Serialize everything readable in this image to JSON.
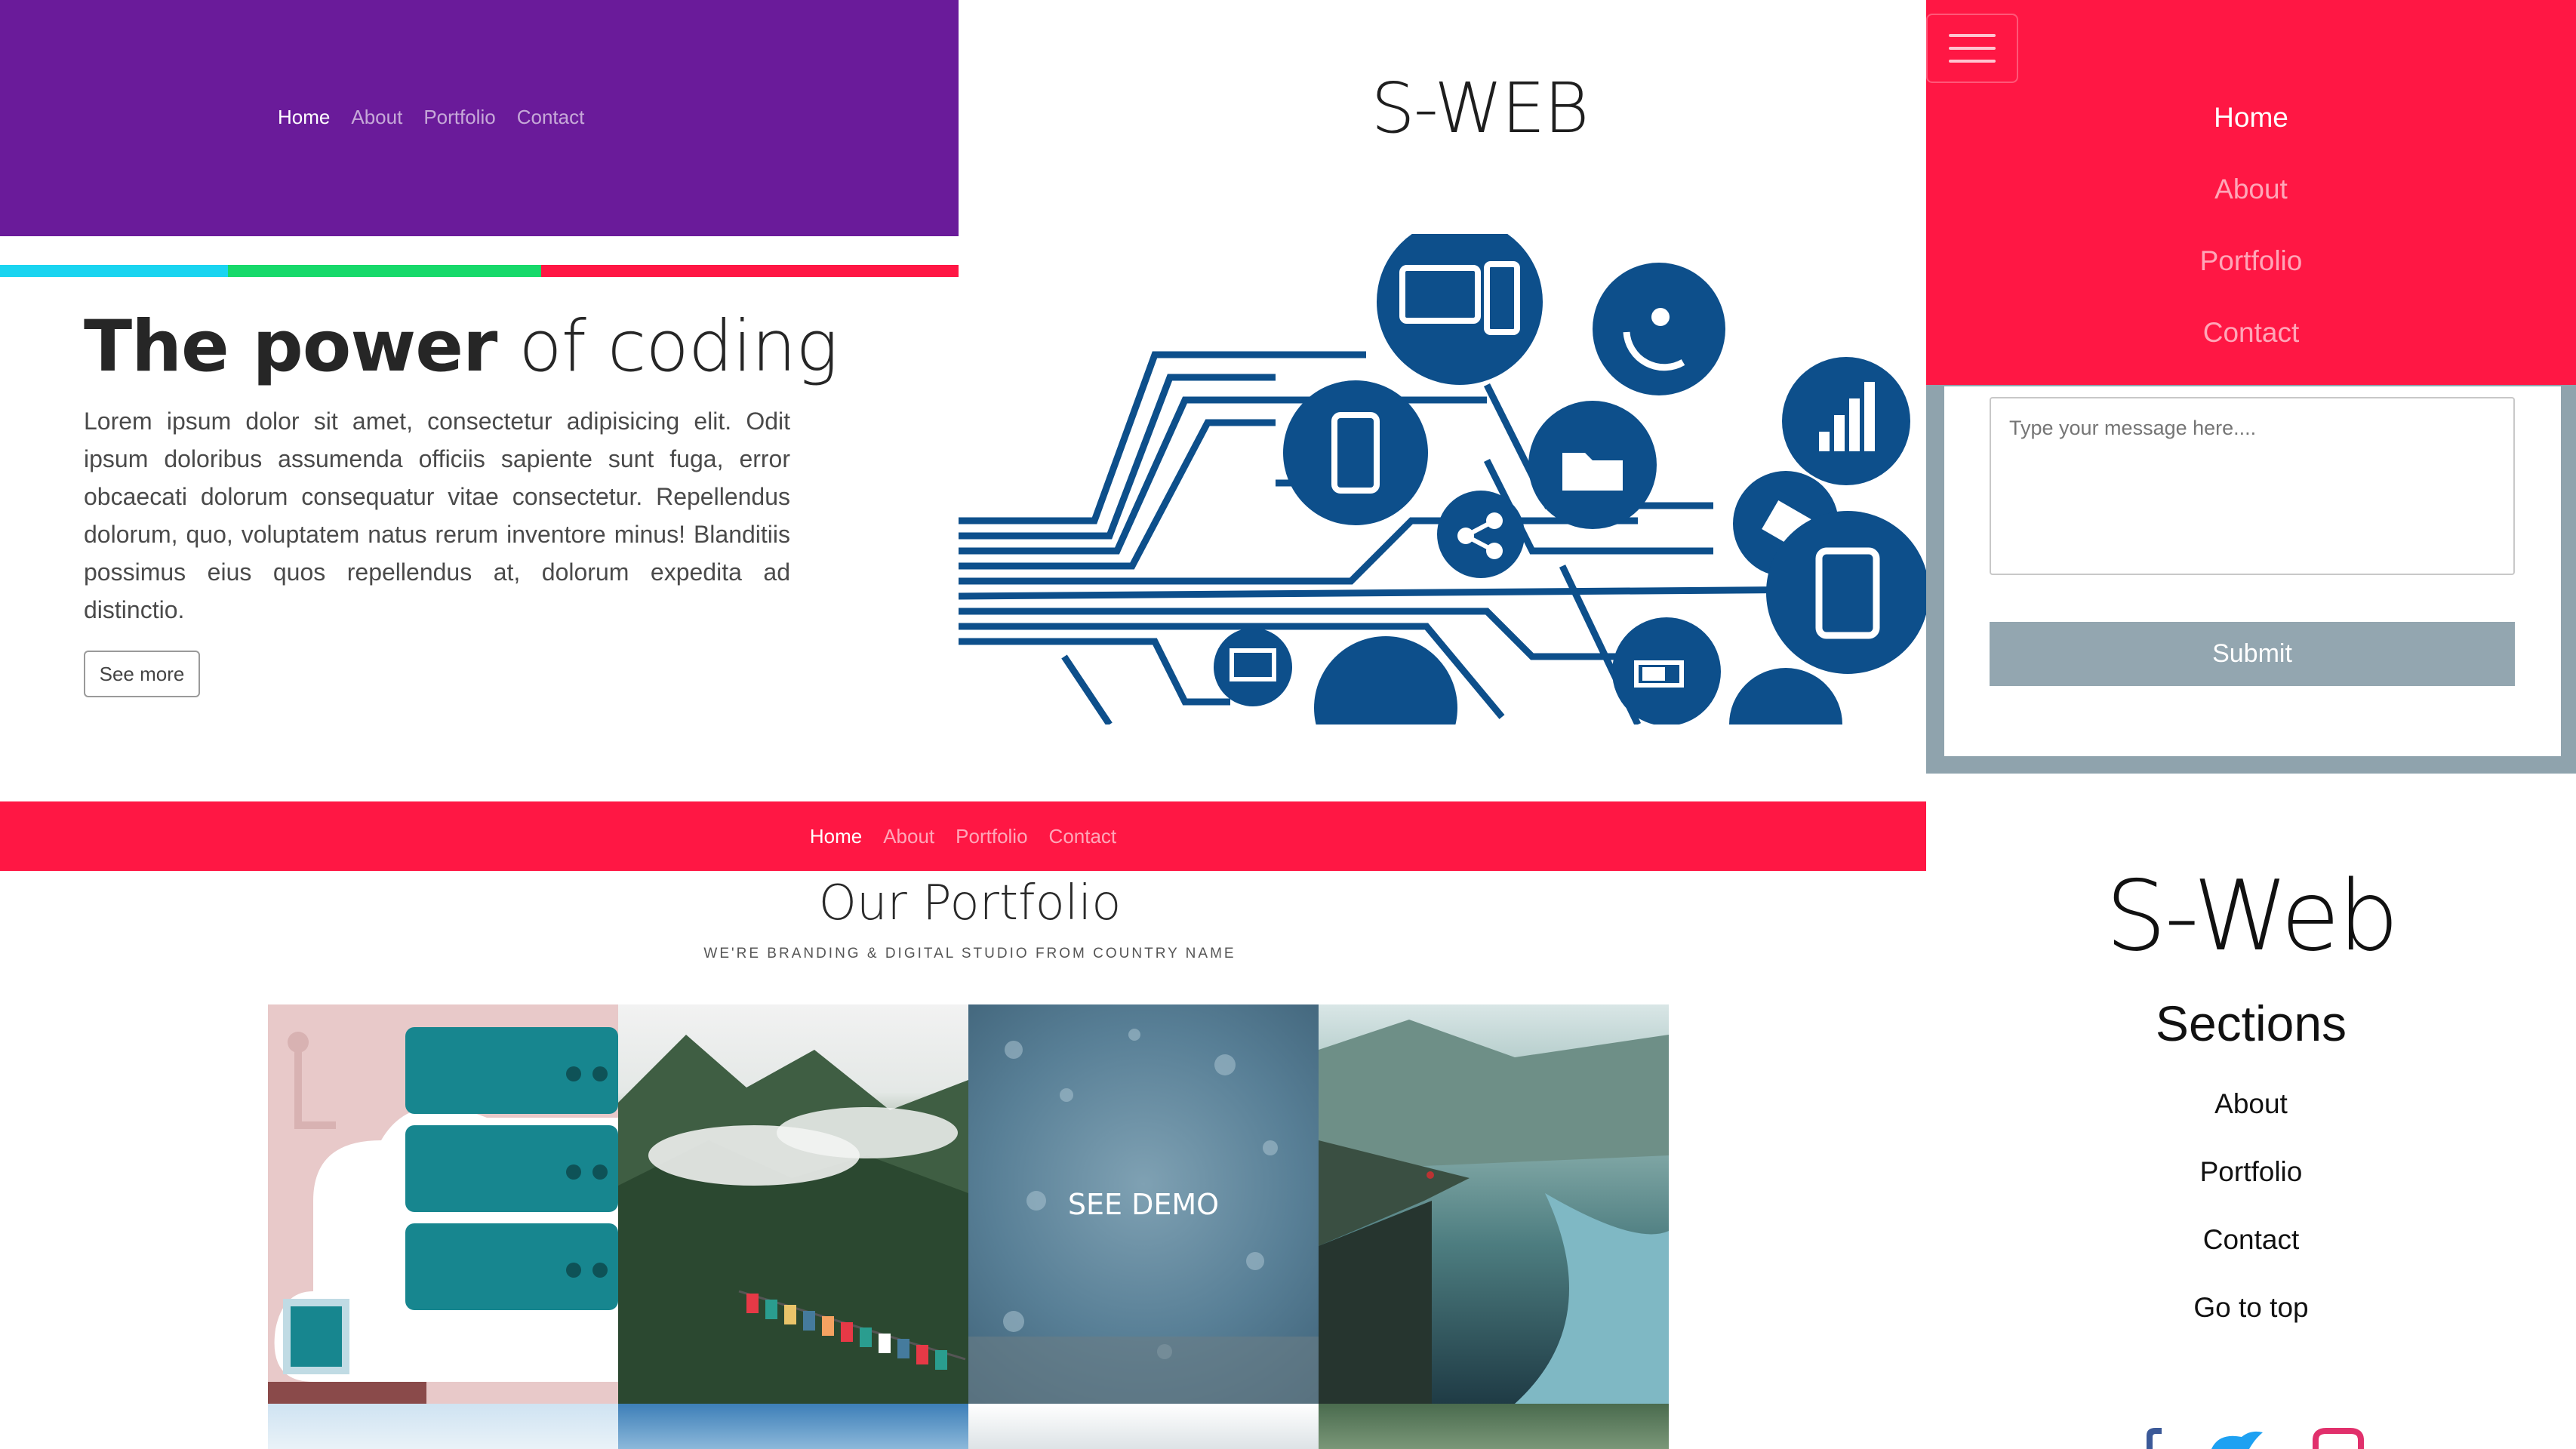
{
  "top_nav": {
    "items": [
      "Home",
      "About",
      "Portfolio",
      "Contact"
    ],
    "active": "Home"
  },
  "hero": {
    "title_strong": "The power",
    "title_rest": " of coding",
    "text": "Lorem ipsum dolor sit amet, consectetur adipisicing elit. Odit ipsum doloribus assumenda officiis sapiente sunt fuga, error obcaecati dolorum consequatur vitae consectetur. Repellendus dolorum, quo, voluptatem natus rerum inventore minus! Blanditiis possimus eius quos repellendus at, dolorum expedita ad distinctio.",
    "button": "See more"
  },
  "brand_title": "S-WEB",
  "mobile_menu": {
    "items": [
      "Home",
      "About",
      "Portfolio",
      "Contact"
    ],
    "active": "Home"
  },
  "contact_form": {
    "message_placeholder": "Type your message here....",
    "submit": "Submit"
  },
  "red_nav": {
    "items": [
      "Home",
      "About",
      "Portfolio",
      "Contact"
    ],
    "active": "Home"
  },
  "portfolio": {
    "title": "Our Portfolio",
    "subtitle": "WE'RE BRANDING & DIGITAL STUDIO FROM COUNTRY NAME",
    "demo_label": "SEE DEMO"
  },
  "footer": {
    "brand": "S-Web",
    "sections_title": "Sections",
    "links": [
      "About",
      "Portfolio",
      "Contact",
      "Go to top"
    ]
  },
  "colors": {
    "purple": "#6a1b9a",
    "red": "#ff1744",
    "icon_blue": "#0d4f8b",
    "stripe": [
      "#1ad4f0",
      "#17d96a",
      "#ff1744"
    ]
  },
  "icons": [
    "menu-icon",
    "monitor-icon",
    "satellite-dish-icon",
    "signal-bars-icon",
    "smartphone-icon",
    "folder-icon",
    "share-icon",
    "satellite-icon",
    "tablet-icon",
    "laptop-icon",
    "cloud-icon",
    "battery-icon",
    "gear-icon",
    "facebook-icon",
    "twitter-icon",
    "instagram-icon"
  ]
}
